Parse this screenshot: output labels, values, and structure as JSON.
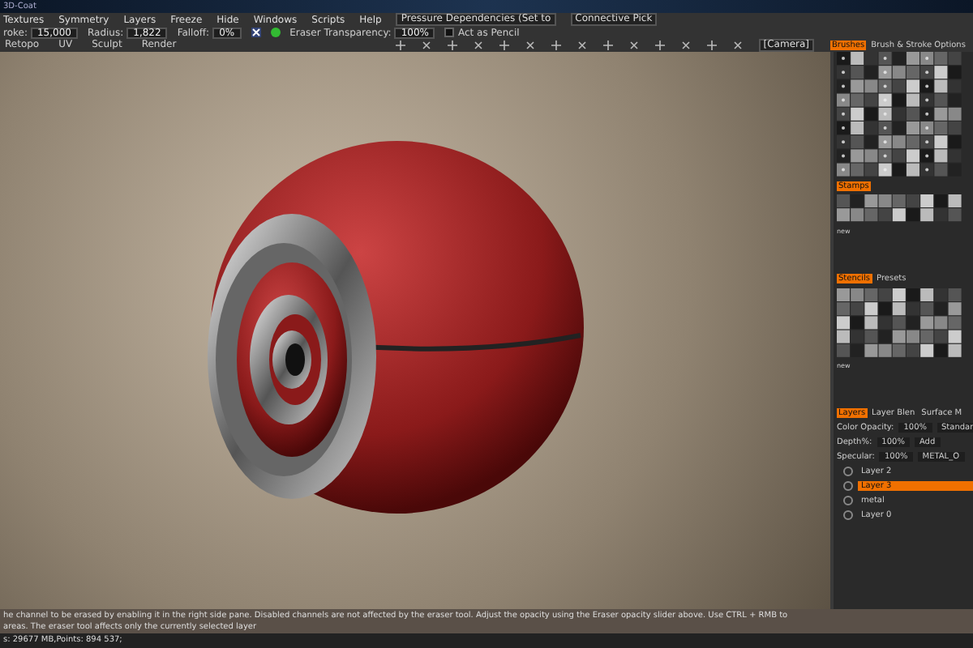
{
  "window": {
    "title": "3D-Coat"
  },
  "menu": [
    "Textures",
    "Symmetry",
    "Layers",
    "Freeze",
    "Hide",
    "Windows",
    "Scripts",
    "Help"
  ],
  "menu_right": {
    "dropdown": "Pressure Dependencies (Set to",
    "pick": "Connective Pick"
  },
  "toolbar": [
    {
      "kind": "field",
      "label": "roke:",
      "value": "15,000"
    },
    {
      "kind": "field",
      "label": "Radius:",
      "value": "1,822"
    },
    {
      "kind": "field",
      "label": "Falloff:",
      "value": "0%"
    },
    {
      "kind": "field",
      "label": "Eraser Transparency:",
      "value": "100%"
    },
    {
      "kind": "check",
      "label": "Act as Pencil",
      "checked": false
    }
  ],
  "rooms": [
    {
      "label": "Retopo",
      "selected": false
    },
    {
      "label": "UV",
      "selected": false
    },
    {
      "label": "Sculpt",
      "selected": false
    },
    {
      "label": "Render",
      "selected": false
    }
  ],
  "camera": "[Camera]",
  "brush_tabs": [
    {
      "label": "Brushes",
      "selected": true
    },
    {
      "label": "Brush & Stroke Options",
      "selected": false
    }
  ],
  "stamps": {
    "title": "Stamps",
    "new_label": "new"
  },
  "stencil_tabs": [
    {
      "label": "Stencils",
      "selected": true
    },
    {
      "label": "Presets",
      "selected": false
    }
  ],
  "stencils": {
    "new_label": "new"
  },
  "layer_tabs": [
    {
      "label": "Layers",
      "selected": true
    },
    {
      "label": "Layer Blen",
      "selected": false
    },
    {
      "label": "Surface M",
      "selected": false
    }
  ],
  "layer_props": [
    {
      "label": "Color Opacity:",
      "value": "100%",
      "mode": "Standar"
    },
    {
      "label": "Depth%:",
      "value": "100%",
      "mode": "Add"
    },
    {
      "label": "Specular:",
      "value": "100%",
      "mode": "METAL_O"
    }
  ],
  "layers": [
    {
      "name": "Layer 2",
      "selected": false
    },
    {
      "name": "Layer 3",
      "selected": true
    },
    {
      "name": "metal",
      "selected": false
    },
    {
      "name": "Layer 0",
      "selected": false
    }
  ],
  "hint": [
    "he channel to be erased by enabling it in the right side pane.  Disabled channels are not affected by the eraser tool. Adjust the opacity using the Eraser opacity slider above. Use CTRL + RMB to",
    "areas. The eraser tool affects only the currently selected layer"
  ],
  "status_bar": "s: 29677 MB,Points: 894 537;"
}
